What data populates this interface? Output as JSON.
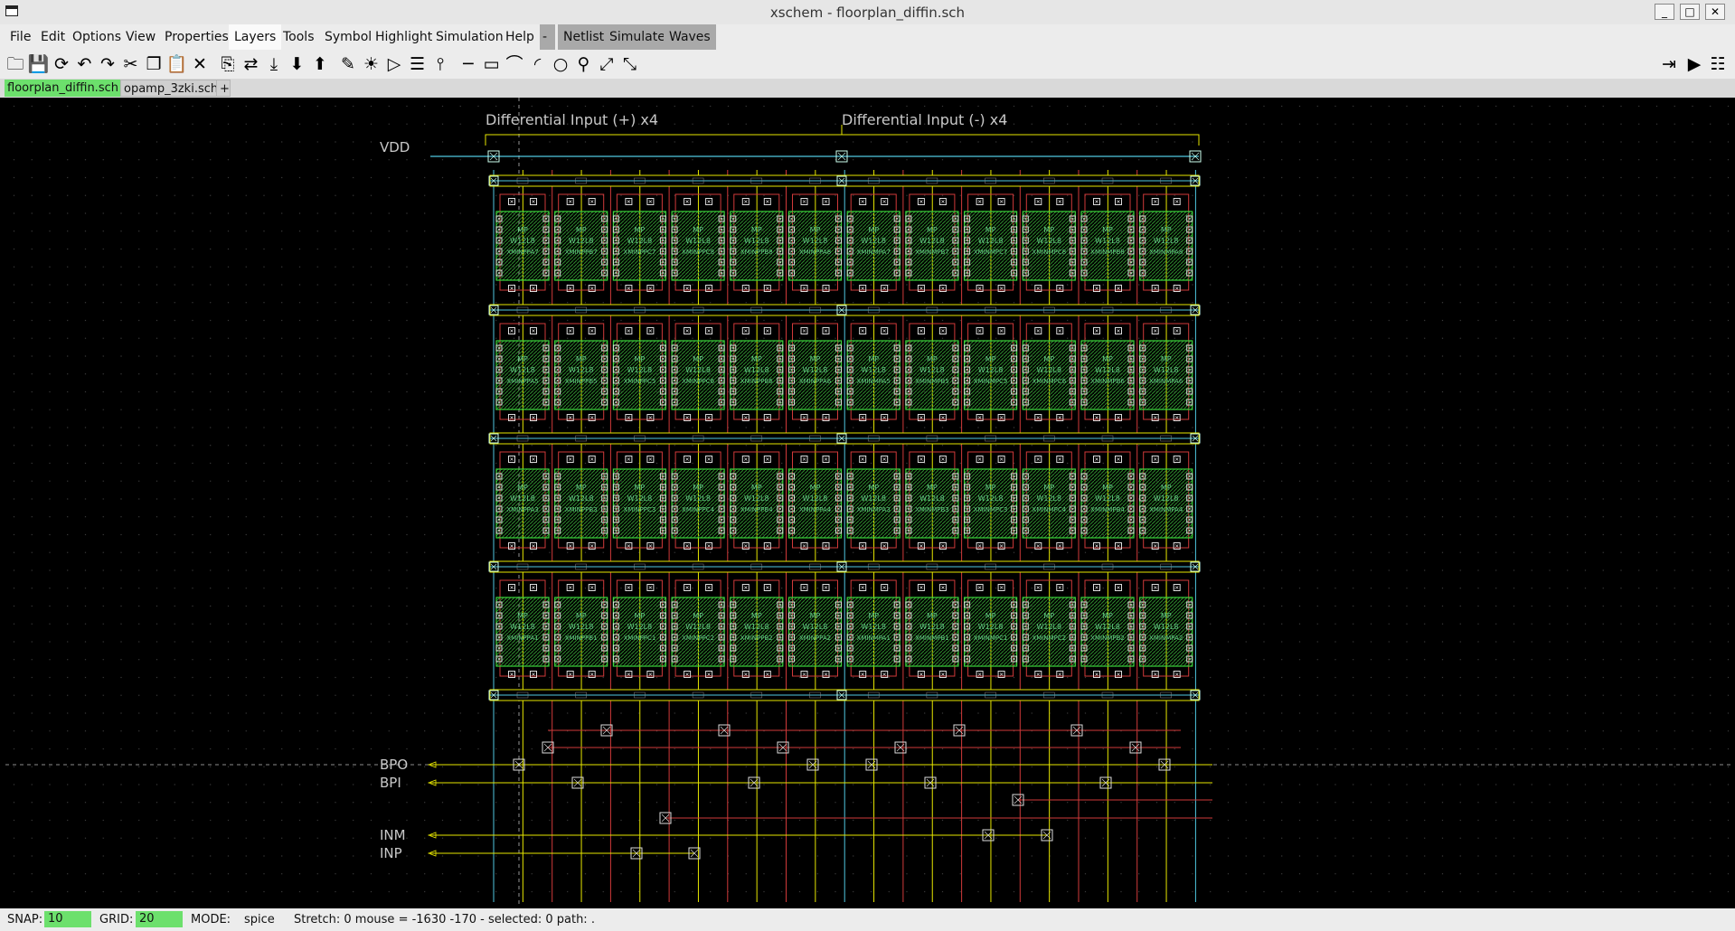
{
  "window": {
    "title": "xschem - floorplan_diffin.sch"
  },
  "menu": [
    "File",
    "Edit",
    "Options",
    "View",
    "Properties",
    "Layers",
    "Tools",
    "Symbol",
    "Highlight",
    "Simulation",
    "Help",
    "-",
    "Netlist",
    "Simulate",
    "Waves"
  ],
  "toolbar_left": [
    "open-icon",
    "save-icon",
    "reload-icon",
    "undo-icon",
    "redo-icon",
    "cut-icon",
    "copy-icon",
    "paste-icon",
    "delete-icon",
    "insert-symbol-icon",
    "swap-icon",
    "push-icon",
    "descend-icon",
    "ascend-icon",
    "wire-icon",
    "net-highlight-icon",
    "pin-icon",
    "label-icon",
    "probe-icon",
    "line-icon",
    "rect-icon",
    "poly-icon",
    "arc-icon",
    "circle-icon",
    "zoom-icon",
    "zoom-in-icon",
    "zoom-full-icon"
  ],
  "toolbar_right": [
    "netlist-icon",
    "simulate-icon",
    "waves-icon"
  ],
  "tabs": [
    "floorplan_diffin.sch",
    "opamp_3zki.sch",
    "+"
  ],
  "schematic": {
    "headers": [
      "Differential Input (+) x4",
      "Differential Input (-) x4"
    ],
    "pins": [
      "VDD",
      "BPO",
      "BPI",
      "INM",
      "INP"
    ],
    "device_type": "MP",
    "device_size": "W12L8",
    "rows": [
      [
        "XMINPPA7",
        "XMINPPB7",
        "XMINPPC7",
        "XMINPPC8",
        "XMINPPB8",
        "XMINPPA8",
        "XMINMPA7",
        "XMINMPB7",
        "XMINMPC7",
        "XMINMPC8",
        "XMINMPB8",
        "XMINMPA8"
      ],
      [
        "XMINPPA5",
        "XMINPPB5",
        "XMINPPC5",
        "XMINPPC6",
        "XMINPPB6",
        "XMINPPA6",
        "XMINMPA5",
        "XMINMPB5",
        "XMINMPC5",
        "XMINMPC6",
        "XMINMPB6",
        "XMINMPA6"
      ],
      [
        "XMINPPA3",
        "XMINPPB3",
        "XMINPPC3",
        "XMINPPC4",
        "XMINPPB4",
        "XMINPPA4",
        "XMINMPA3",
        "XMINMPB3",
        "XMINMPC3",
        "XMINMPC4",
        "XMINMPB4",
        "XMINMPA4"
      ],
      [
        "XMINPPA1",
        "XMINPPB1",
        "XMINPPC1",
        "XMINPPC2",
        "XMINPPB2",
        "XMINPPA2",
        "XMINMPA1",
        "XMINMPB1",
        "XMINMPC1",
        "XMINMPC2",
        "XMINMPB2",
        "XMINMPA2"
      ]
    ]
  },
  "status": {
    "snap_label": "SNAP:",
    "snap": "10",
    "grid_label": "GRID:",
    "grid": "20",
    "mode_label": "MODE:",
    "mode": "spice",
    "info": "Stretch: 0  mouse = -1630 -170 - selected: 0 path: ."
  },
  "colors": {
    "wire_yellow": "#e6e600",
    "wire_red": "#d03a3a",
    "wire_cyan": "#4fc8e0",
    "device_green": "#3bd63b",
    "text_gray": "#c8c8c8"
  }
}
